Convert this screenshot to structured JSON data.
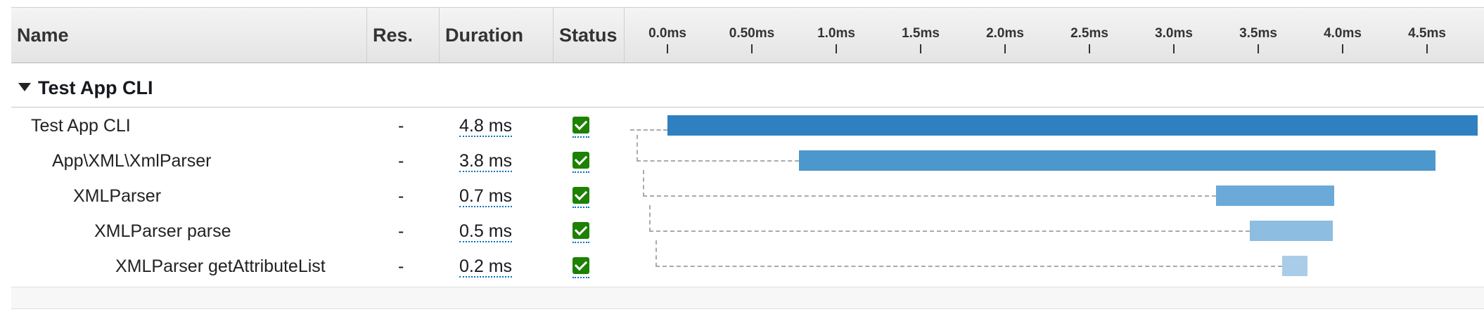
{
  "columns": {
    "name": "Name",
    "res": "Res.",
    "duration": "Duration",
    "status": "Status"
  },
  "timeline_ticks": [
    "0.0ms",
    "0.50ms",
    "1.0ms",
    "1.5ms",
    "2.0ms",
    "2.5ms",
    "3.0ms",
    "3.5ms",
    "4.0ms",
    "4.5ms"
  ],
  "group": {
    "title": "Test App CLI"
  },
  "rows": [
    {
      "name": "Test App CLI",
      "res": "-",
      "duration": "4.8 ms",
      "status": "ok",
      "start_ms": 0.0,
      "end_ms": 4.8
    },
    {
      "name": "App\\XML\\XmlParser",
      "res": "-",
      "duration": "3.8 ms",
      "status": "ok",
      "start_ms": 0.78,
      "end_ms": 4.55
    },
    {
      "name": "XMLParser",
      "res": "-",
      "duration": "0.7 ms",
      "status": "ok",
      "start_ms": 3.25,
      "end_ms": 3.95
    },
    {
      "name": "XMLParser parse",
      "res": "-",
      "duration": "0.5 ms",
      "status": "ok",
      "start_ms": 3.45,
      "end_ms": 3.94
    },
    {
      "name": "XMLParser getAttributeList",
      "res": "-",
      "duration": "0.2 ms",
      "status": "ok",
      "start_ms": 3.64,
      "end_ms": 3.79
    }
  ],
  "colors": {
    "bar_level_0": "#2f80c1",
    "bar_level_1": "#4c97cc",
    "bar_level_2": "#6aa9d8",
    "bar_level_3": "#8dbde0",
    "bar_level_4": "#a9cde8",
    "status_ok": "#1d8102"
  }
}
